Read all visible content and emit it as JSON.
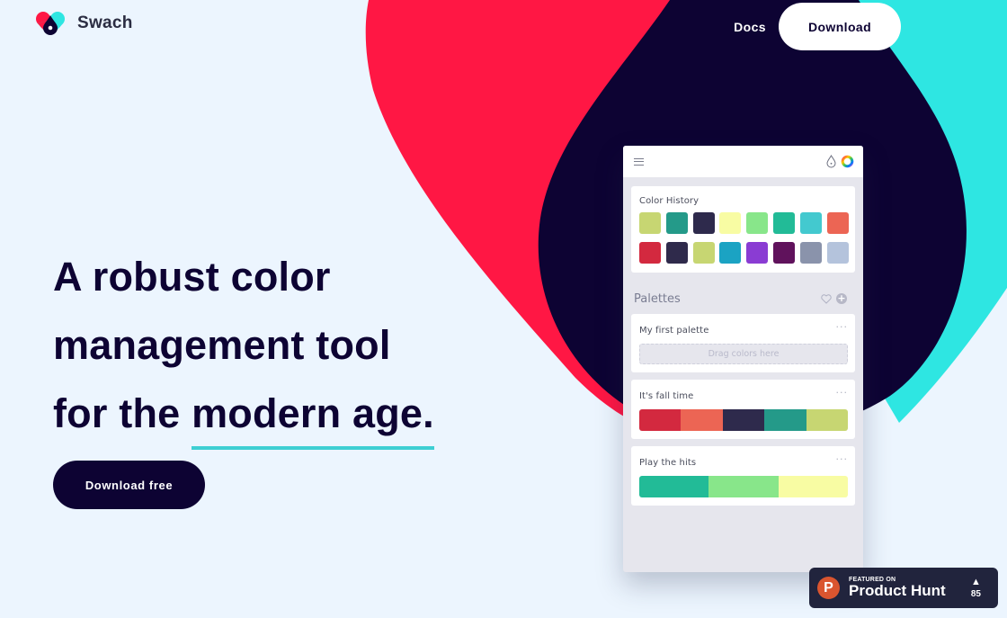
{
  "brand": {
    "name": "Swach",
    "colors": {
      "red": "#ff1744",
      "navy": "#0d0333",
      "cyan": "#2ee6e2",
      "bg": "#ecf5fe",
      "underline": "#3ecfd3"
    }
  },
  "nav": {
    "docs_label": "Docs",
    "download_label": "Download"
  },
  "hero": {
    "line1": "A robust color",
    "line2": "management tool",
    "line3_prefix": "for the ",
    "line3_highlight": "modern age.",
    "cta_label": "Download free"
  },
  "app": {
    "menu_icon": "hamburger-icon",
    "dropper_icon": "eyedropper-icon",
    "picker_icon": "color-wheel-icon",
    "color_history": {
      "title": "Color History",
      "colors": [
        "#c7d672",
        "#249a89",
        "#2e2a4c",
        "#f8fca3",
        "#88e68a",
        "#22bb97",
        "#43c9cf",
        "#ec6554",
        "#d3293f",
        "#2f2a4b",
        "#c7d672",
        "#1ba3c3",
        "#8a3cd3",
        "#60125c",
        "#8a93ab",
        "#b4c3dc"
      ]
    },
    "palettes": {
      "title": "Palettes",
      "favorite_icon": "heart-icon",
      "add_icon": "plus-circle-icon",
      "items": [
        {
          "name": "My first palette",
          "empty_text": "Drag colors here",
          "colors": []
        },
        {
          "name": "It's fall time",
          "colors": [
            "#d3293f",
            "#ec6554",
            "#2e2a4c",
            "#249a89",
            "#c7d672"
          ]
        },
        {
          "name": "Play the hits",
          "colors": [
            "#22bb97",
            "#88e68a",
            "#f8fca3"
          ]
        }
      ],
      "more_label": "···"
    }
  },
  "product_hunt": {
    "featured_label": "FEATURED ON",
    "name": "Product Hunt",
    "logo_letter": "P",
    "upvote_symbol": "▲",
    "votes": "85"
  }
}
